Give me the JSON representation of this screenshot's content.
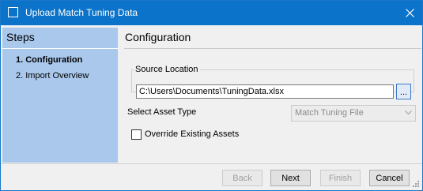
{
  "window": {
    "title": "Upload Match Tuning Data"
  },
  "steps": {
    "title": "Steps",
    "items": [
      {
        "label": "1. Configuration",
        "active": true
      },
      {
        "label": "2. Import Overview",
        "active": false
      }
    ]
  },
  "configuration": {
    "title": "Configuration",
    "source": {
      "label": "Source Location",
      "value": "C:\\Users\\Documents\\TuningData.xlsx",
      "browse_label": "..."
    },
    "asset_type": {
      "label": "Select Asset Type",
      "selected": "Match Tuning File",
      "enabled": false
    },
    "override": {
      "label": "Override Existing Assets",
      "checked": false
    }
  },
  "footer": {
    "back_label": "Back",
    "next_label": "Next",
    "finish_label": "Finish",
    "cancel_label": "Cancel"
  },
  "colors": {
    "titlebar": "#0b73c9",
    "steps_panel": "#a9c8ec",
    "window_bg": "#f0f0f0"
  }
}
